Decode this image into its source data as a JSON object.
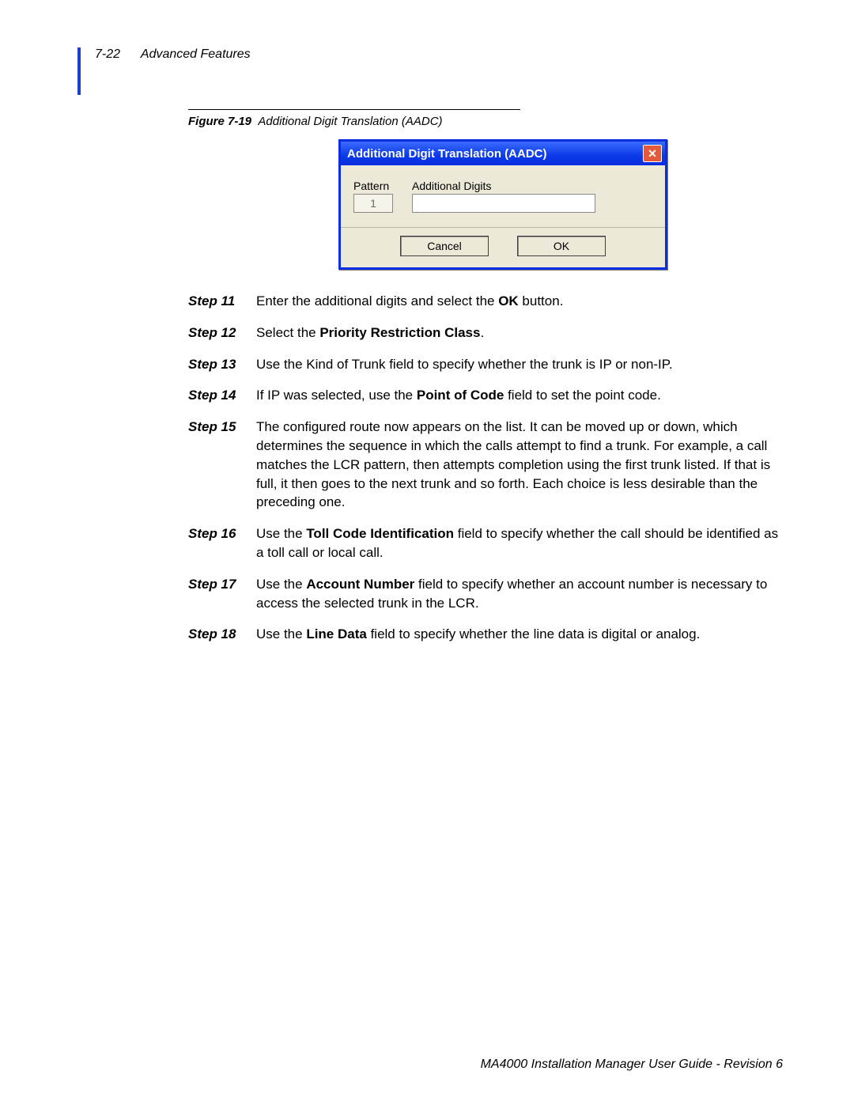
{
  "header": {
    "page": "7-22",
    "section": "Advanced Features"
  },
  "figure": {
    "label": "Figure 7-19",
    "caption": "Additional Digit Translation (AADC)"
  },
  "dialog": {
    "title": "Additional Digit Translation (AADC)",
    "pattern_label": "Pattern",
    "pattern_value": "1",
    "additional_label": "Additional Digits",
    "cancel": "Cancel",
    "ok": "OK"
  },
  "steps": [
    {
      "label": "Step 11",
      "t1": "Enter the additional digits and select the ",
      "b1": "OK",
      "t2": " button."
    },
    {
      "label": "Step 12",
      "t1": "Select the ",
      "b1": "Priority Restriction Class",
      "t2": "."
    },
    {
      "label": "Step 13",
      "t1": "Use the Kind of Trunk field to specify whether the trunk is IP or non-IP."
    },
    {
      "label": "Step 14",
      "t1": "If IP was selected, use the ",
      "b1": "Point of Code",
      "t2": " field to set the point code."
    },
    {
      "label": "Step 15",
      "t1": "The configured route now appears on the list. It can be moved up or down, which determines the sequence in which the calls attempt to find a trunk. For example, a call matches the LCR pattern, then attempts completion using the first trunk listed. If that is full, it then goes to the next trunk and so forth. Each choice is less desirable than the preceding one."
    },
    {
      "label": "Step 16",
      "t1": "Use the ",
      "b1": "Toll Code Identification",
      "t2": " field to specify whether the call should be identified as a toll call or local call."
    },
    {
      "label": "Step 17",
      "t1": "Use the ",
      "b1": "Account Number",
      "t2": " field to specify whether an account number is necessary to access the selected trunk in the LCR."
    },
    {
      "label": "Step 18",
      "t1": "Use the ",
      "b1": "Line Data",
      "t2": " field to specify whether the line data is digital or analog."
    }
  ],
  "footer": "MA4000 Installation Manager User Guide - Revision 6"
}
